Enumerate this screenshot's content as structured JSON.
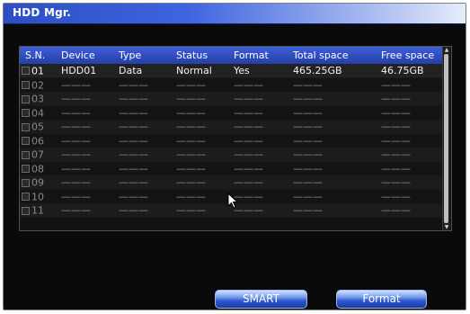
{
  "window": {
    "title": "HDD Mgr."
  },
  "table": {
    "columns": [
      "S.N.",
      "Device",
      "Type",
      "Status",
      "Format",
      "Total space",
      "Free space"
    ],
    "rows": [
      {
        "sn": "01",
        "device": "HDD01",
        "type": "Data",
        "status": "Normal",
        "format": "Yes",
        "total": "465.25GB",
        "free": "46.75GB"
      },
      {
        "sn": "02",
        "device": "———",
        "type": "———",
        "status": "———",
        "format": "———",
        "total": "———",
        "free": "———"
      },
      {
        "sn": "03",
        "device": "———",
        "type": "———",
        "status": "———",
        "format": "———",
        "total": "———",
        "free": "———"
      },
      {
        "sn": "04",
        "device": "———",
        "type": "———",
        "status": "———",
        "format": "———",
        "total": "———",
        "free": "———"
      },
      {
        "sn": "05",
        "device": "———",
        "type": "———",
        "status": "———",
        "format": "———",
        "total": "———",
        "free": "———"
      },
      {
        "sn": "06",
        "device": "———",
        "type": "———",
        "status": "———",
        "format": "———",
        "total": "———",
        "free": "———"
      },
      {
        "sn": "07",
        "device": "———",
        "type": "———",
        "status": "———",
        "format": "———",
        "total": "———",
        "free": "———"
      },
      {
        "sn": "08",
        "device": "———",
        "type": "———",
        "status": "———",
        "format": "———",
        "total": "———",
        "free": "———"
      },
      {
        "sn": "09",
        "device": "———",
        "type": "———",
        "status": "———",
        "format": "———",
        "total": "———",
        "free": "———"
      },
      {
        "sn": "10",
        "device": "———",
        "type": "———",
        "status": "———",
        "format": "———",
        "total": "———",
        "free": "———"
      },
      {
        "sn": "11",
        "device": "———",
        "type": "———",
        "status": "———",
        "format": "———",
        "total": "———",
        "free": "———"
      }
    ]
  },
  "buttons": {
    "smart_label": "SMART",
    "format_label": "Format"
  },
  "icons": {
    "scroll_up": "scroll-up-arrow-icon",
    "scroll_down": "scroll-down-arrow-icon",
    "cursor": "mouse-pointer-icon",
    "checkbox": "checkbox-icon"
  },
  "colors": {
    "title_bar_start": "#2d4fc2",
    "header_row": "#3050c8",
    "background": "#0a0a0a"
  }
}
